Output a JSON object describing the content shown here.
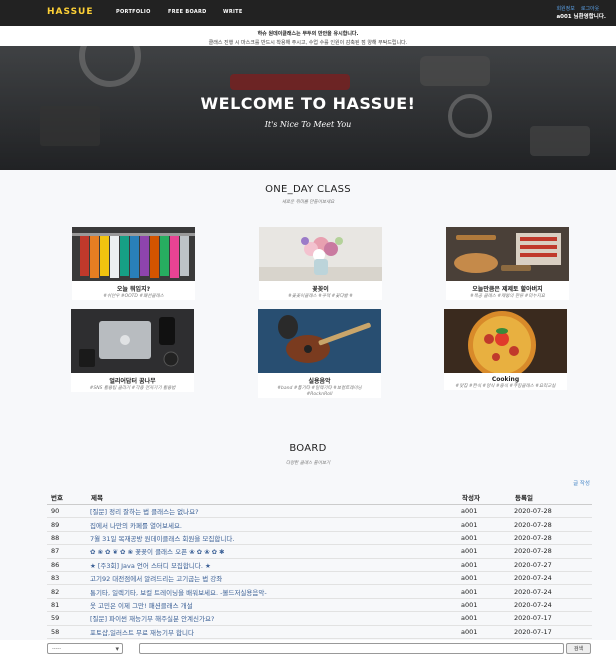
{
  "nav": {
    "brand": "HASSUE",
    "links": [
      "PORTFOLIO",
      "FREE BOARD",
      "WRITE"
    ],
    "right_links": [
      "회원정보",
      "로그아웃"
    ],
    "greeting": "a001 님환영합니다."
  },
  "notice": {
    "line1": "하슈 원데이클래스는 무두의 만안을 유시합니다.",
    "line2": "클래스 진행 시 마스크를 반드시 착용해 주시고, 수업 수를 인원이 감축된 점 양해 부탁드립니다."
  },
  "hero": {
    "title": "WELCOME TO HASSUE!",
    "subtitle": "It's Nice To Meet You"
  },
  "classes": {
    "title": "ONE_DAY CLASS",
    "subtitle": "새로운 취미를 만들어보세요",
    "items": [
      {
        "title": "오늘 뭐입지?",
        "tags": "#쉬안우 #OOTD #패션클래스"
      },
      {
        "title": "꽃꽂이",
        "tags": "#꽃꽂이클래스 #꾸꺽 #꽃다발 #"
      },
      {
        "title": "오늘만큼은 제제토 할아버지",
        "tags": "#목공 클래스 #제봉의 판류 #미누지요"
      },
      {
        "title": "얼리어답터 꿈나무",
        "tags": "#SNS 활용팁 클라기 #각종 전자기기 활용법"
      },
      {
        "title": "실용음악",
        "tags": "#band #통기타 #일렉기타 #보컬트레이닝 #RocknRoll"
      },
      {
        "title": "Cooking",
        "tags": "#맛집 #한식 #양식 #중식 #쿠킹클래스 #요리교실"
      }
    ]
  },
  "board": {
    "title": "BOARD",
    "subtitle": "다양한 클래스 물어보기",
    "write_label": "글 작성",
    "headers": [
      "번호",
      "제목",
      "작성자",
      "등록일"
    ],
    "rows": [
      {
        "no": "90",
        "title": "[질문] 정리 잘하는 법 클래스는 없나요?",
        "author": "a001",
        "date": "2020-07-28"
      },
      {
        "no": "89",
        "title": "집에서 나만의 카페를 열어보세요.",
        "author": "a001",
        "date": "2020-07-28"
      },
      {
        "no": "88",
        "title": "7월 31일 목재공방 원데이클래스 회원을 모집합니다.",
        "author": "a001",
        "date": "2020-07-28"
      },
      {
        "no": "87",
        "title": "✿ ❀ ✿ ❦ ✿ ❀ 꽃꽂이 클래스 오픈 ❀ ✿ ❀ ✿ ✱",
        "author": "a001",
        "date": "2020-07-28"
      },
      {
        "no": "86",
        "title": "★ [주3회] Java 언어 스터디 모집합니다. ★",
        "author": "a001",
        "date": "2020-07-27"
      },
      {
        "no": "83",
        "title": "고기92 대전점에서 알려드리는 고기굽는 법 강좌",
        "author": "a001",
        "date": "2020-07-24"
      },
      {
        "no": "82",
        "title": "통기타, 일렉기타, 보컬 트레이닝을 배워보세요. -볼드저실용음악-",
        "author": "a001",
        "date": "2020-07-24"
      },
      {
        "no": "81",
        "title": "옷 고민은 이제 그만! 패션클래스 개설",
        "author": "a001",
        "date": "2020-07-24"
      },
      {
        "no": "59",
        "title": "[질문] 파이썬 재능기부 해주실분 안계신가요?",
        "author": "a001",
        "date": "2020-07-17"
      },
      {
        "no": "58",
        "title": "포토샵,일러스트 무료 재능기부 합니다",
        "author": "a001",
        "date": "2020-07-17"
      }
    ]
  },
  "search": {
    "select_value": "-----",
    "button_label": "검색"
  }
}
